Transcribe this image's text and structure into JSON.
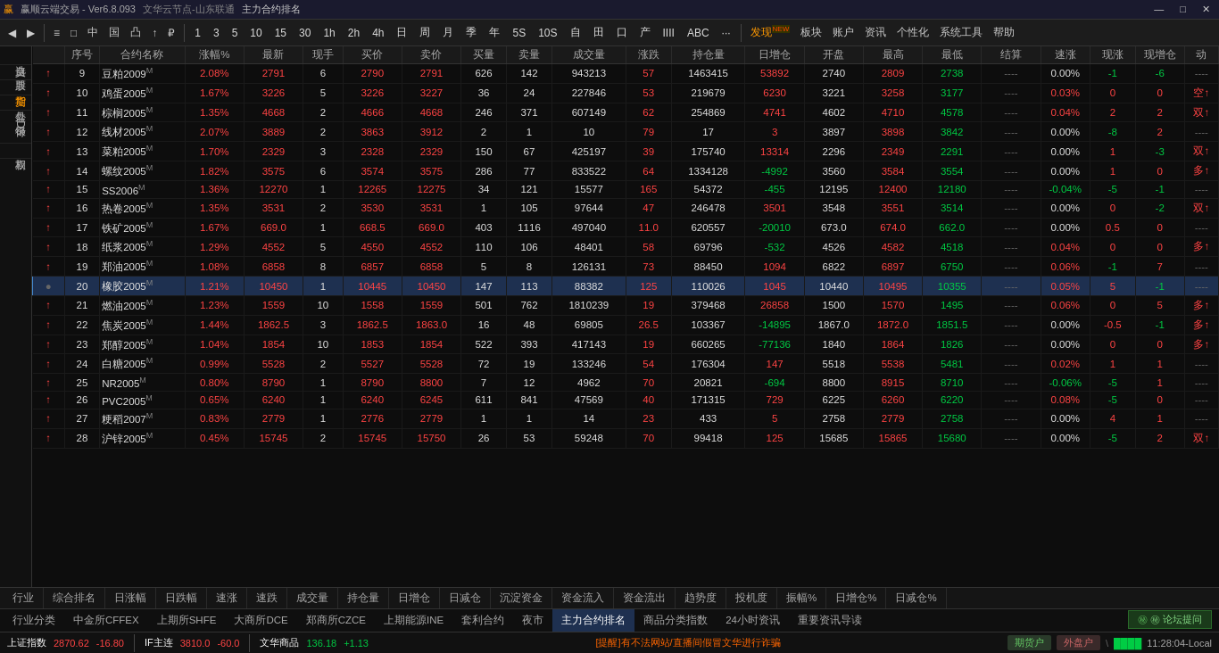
{
  "titlebar": {
    "title": "赢顺云端交易 - Ver6.8.093",
    "server": "文华云节点-山东联通",
    "contract": "主力合约排名",
    "minimize": "—",
    "maximize": "□",
    "close": "✕"
  },
  "toolbar": {
    "nav_back": "◀",
    "nav_fwd": "▶",
    "buttons": [
      "≡",
      "□",
      "中",
      "国",
      "凸",
      "↑",
      "₽"
    ],
    "periods": [
      "1",
      "3",
      "5",
      "10",
      "15",
      "30",
      "1h",
      "2h",
      "4h",
      "日",
      "周",
      "月",
      "季",
      "年",
      "5S",
      "10S",
      "自",
      "田",
      "口",
      "产",
      "IIII",
      "ABC",
      "···"
    ],
    "tools_right": [
      "发现",
      "板块",
      "账户",
      "资讯",
      "个性化",
      "系统工具",
      "帮助"
    ]
  },
  "sidebar": {
    "items": [
      "自选义",
      "股票",
      "期货",
      "外盘",
      "银行IDS",
      "期权"
    ]
  },
  "table": {
    "headers": [
      "序号",
      "合约名称",
      "涨幅%",
      "最新",
      "现手",
      "买价",
      "卖价",
      "买量",
      "卖量",
      "成交量",
      "涨跌",
      "持仓量",
      "日增仓",
      "开盘",
      "最高",
      "最低",
      "结算",
      "速涨",
      "现涨",
      "现增仓",
      "动"
    ],
    "rows": [
      {
        "seq": "↑",
        "num": "9",
        "name": "豆粕2009",
        "tag": "M",
        "pct": "2.08%",
        "last": "2791",
        "hand": "6",
        "buy": "2790",
        "sell": "2791",
        "bvol": "626",
        "svol": "142",
        "deal": "943213",
        "limit": "57",
        "pos": "1463415",
        "dadd": "53892",
        "open": "2740",
        "high": "2809",
        "low": "2738",
        "settle": "----",
        "speed": "0.00%",
        "xian": "-1",
        "cang": "-6",
        "dong": "----",
        "pct_color": "red",
        "last_color": "red"
      },
      {
        "seq": "↑",
        "num": "10",
        "name": "鸡蛋2005",
        "tag": "M",
        "pct": "1.67%",
        "last": "3226",
        "hand": "5",
        "buy": "3226",
        "sell": "3227",
        "bvol": "36",
        "svol": "24",
        "deal": "227846",
        "limit": "53",
        "pos": "219679",
        "dadd": "6230",
        "open": "3221",
        "high": "3258",
        "low": "3177",
        "settle": "----",
        "speed": "0.03%",
        "xian": "0",
        "cang": "0",
        "dong": "空↑",
        "pct_color": "red",
        "last_color": "red"
      },
      {
        "seq": "↑",
        "num": "11",
        "name": "棕榈2005",
        "tag": "M",
        "pct": "1.35%",
        "last": "4668",
        "hand": "2",
        "buy": "4666",
        "sell": "4668",
        "bvol": "246",
        "svol": "371",
        "deal": "607149",
        "limit": "62",
        "pos": "254869",
        "dadd": "4741",
        "open": "4602",
        "high": "4710",
        "low": "4578",
        "settle": "----",
        "speed": "0.04%",
        "xian": "2",
        "cang": "2",
        "dong": "双↑",
        "pct_color": "red",
        "last_color": "red"
      },
      {
        "seq": "↑",
        "num": "12",
        "name": "线材2005",
        "tag": "M",
        "pct": "2.07%",
        "last": "3889",
        "hand": "2",
        "buy": "3863",
        "sell": "3912",
        "bvol": "2",
        "svol": "1",
        "deal": "10",
        "limit": "79",
        "pos": "17",
        "dadd": "3",
        "open": "3897",
        "high": "3898",
        "low": "3842",
        "settle": "----",
        "speed": "0.00%",
        "xian": "-8",
        "cang": "2",
        "dong": "----",
        "pct_color": "red",
        "last_color": "red"
      },
      {
        "seq": "↑",
        "num": "13",
        "name": "菜粕2005",
        "tag": "M",
        "pct": "1.70%",
        "last": "2329",
        "hand": "3",
        "buy": "2328",
        "sell": "2329",
        "bvol": "150",
        "svol": "67",
        "deal": "425197",
        "limit": "39",
        "pos": "175740",
        "dadd": "13314",
        "open": "2296",
        "high": "2349",
        "low": "2291",
        "settle": "----",
        "speed": "0.00%",
        "xian": "1",
        "cang": "-3",
        "dong": "双↑",
        "pct_color": "red",
        "last_color": "red"
      },
      {
        "seq": "↑",
        "num": "14",
        "name": "螺纹2005",
        "tag": "M",
        "pct": "1.82%",
        "last": "3575",
        "hand": "6",
        "buy": "3574",
        "sell": "3575",
        "bvol": "286",
        "svol": "77",
        "deal": "833522",
        "limit": "64",
        "pos": "1334128",
        "dadd": "-4992",
        "open": "3560",
        "high": "3584",
        "low": "3554",
        "settle": "----",
        "speed": "0.00%",
        "xian": "1",
        "cang": "0",
        "dong": "多↑",
        "pct_color": "red",
        "last_color": "red"
      },
      {
        "seq": "↑",
        "num": "15",
        "name": "SS2006",
        "tag": "M",
        "pct": "1.36%",
        "last": "12270",
        "hand": "1",
        "buy": "12265",
        "sell": "12275",
        "bvol": "34",
        "svol": "121",
        "deal": "15577",
        "limit": "165",
        "pos": "54372",
        "dadd": "-455",
        "open": "12195",
        "high": "12400",
        "low": "12180",
        "settle": "----",
        "speed": "-0.04%",
        "xian": "-5",
        "cang": "-1",
        "dong": "----",
        "pct_color": "red",
        "last_color": "red"
      },
      {
        "seq": "↑",
        "num": "16",
        "name": "热卷2005",
        "tag": "M",
        "pct": "1.35%",
        "last": "3531",
        "hand": "2",
        "buy": "3530",
        "sell": "3531",
        "bvol": "1",
        "svol": "105",
        "deal": "97644",
        "limit": "47",
        "pos": "246478",
        "dadd": "3501",
        "open": "3548",
        "high": "3551",
        "low": "3514",
        "settle": "----",
        "speed": "0.00%",
        "xian": "0",
        "cang": "-2",
        "dong": "双↑",
        "pct_color": "red",
        "last_color": "red"
      },
      {
        "seq": "↑",
        "num": "17",
        "name": "铁矿2005",
        "tag": "M",
        "pct": "1.67%",
        "last": "669.0",
        "hand": "1",
        "buy": "668.5",
        "sell": "669.0",
        "bvol": "403",
        "svol": "1116",
        "deal": "497040",
        "limit": "11.0",
        "pos": "620557",
        "dadd": "-20010",
        "open": "673.0",
        "high": "674.0",
        "low": "662.0",
        "settle": "----",
        "speed": "0.00%",
        "xian": "0.5",
        "cang": "0",
        "dong": "----",
        "pct_color": "red",
        "last_color": "red"
      },
      {
        "seq": "↑",
        "num": "18",
        "name": "纸浆2005",
        "tag": "M",
        "pct": "1.29%",
        "last": "4552",
        "hand": "5",
        "buy": "4550",
        "sell": "4552",
        "bvol": "110",
        "svol": "106",
        "deal": "48401",
        "limit": "58",
        "pos": "69796",
        "dadd": "-532",
        "open": "4526",
        "high": "4582",
        "low": "4518",
        "settle": "----",
        "speed": "0.04%",
        "xian": "0",
        "cang": "0",
        "dong": "多↑",
        "pct_color": "red",
        "last_color": "red"
      },
      {
        "seq": "↑",
        "num": "19",
        "name": "郑油2005",
        "tag": "M",
        "pct": "1.08%",
        "last": "6858",
        "hand": "8",
        "buy": "6857",
        "sell": "6858",
        "bvol": "5",
        "svol": "8",
        "deal": "126131",
        "limit": "73",
        "pos": "88450",
        "dadd": "1094",
        "open": "6822",
        "high": "6897",
        "low": "6750",
        "settle": "----",
        "speed": "0.06%",
        "xian": "-1",
        "cang": "7",
        "dong": "----",
        "pct_color": "red",
        "last_color": "red"
      },
      {
        "seq": "●",
        "num": "20",
        "name": "橡胶2005",
        "tag": "M",
        "pct": "1.21%",
        "last": "10450",
        "hand": "1",
        "buy": "10445",
        "sell": "10450",
        "bvol": "147",
        "svol": "113",
        "deal": "88382",
        "limit": "125",
        "pos": "110026",
        "dadd": "1045",
        "open": "10440",
        "high": "10495",
        "low": "10355",
        "settle": "----",
        "speed": "0.05%",
        "xian": "5",
        "cang": "-1",
        "dong": "----",
        "pct_color": "red",
        "last_color": "red",
        "selected": true
      },
      {
        "seq": "↑",
        "num": "21",
        "name": "燃油2005",
        "tag": "M",
        "pct": "1.23%",
        "last": "1559",
        "hand": "10",
        "buy": "1558",
        "sell": "1559",
        "bvol": "501",
        "svol": "762",
        "deal": "1810239",
        "limit": "19",
        "pos": "379468",
        "dadd": "26858",
        "open": "1500",
        "high": "1570",
        "low": "1495",
        "settle": "----",
        "speed": "0.06%",
        "xian": "0",
        "cang": "5",
        "dong": "多↑",
        "pct_color": "red",
        "last_color": "red"
      },
      {
        "seq": "↑",
        "num": "22",
        "name": "焦炭2005",
        "tag": "M",
        "pct": "1.44%",
        "last": "1862.5",
        "hand": "3",
        "buy": "1862.5",
        "sell": "1863.0",
        "bvol": "16",
        "svol": "48",
        "deal": "69805",
        "limit": "26.5",
        "pos": "103367",
        "dadd": "-14895",
        "open": "1867.0",
        "high": "1872.0",
        "low": "1851.5",
        "settle": "----",
        "speed": "0.00%",
        "xian": "-0.5",
        "cang": "-1",
        "dong": "多↑",
        "pct_color": "red",
        "last_color": "red"
      },
      {
        "seq": "↑",
        "num": "23",
        "name": "郑醇2005",
        "tag": "M",
        "pct": "1.04%",
        "last": "1854",
        "hand": "10",
        "buy": "1853",
        "sell": "1854",
        "bvol": "522",
        "svol": "393",
        "deal": "417143",
        "limit": "19",
        "pos": "660265",
        "dadd": "-77136",
        "open": "1840",
        "high": "1864",
        "low": "1826",
        "settle": "----",
        "speed": "0.00%",
        "xian": "0",
        "cang": "0",
        "dong": "多↑",
        "pct_color": "red",
        "last_color": "red"
      },
      {
        "seq": "↑",
        "num": "24",
        "name": "白糖2005",
        "tag": "M",
        "pct": "0.99%",
        "last": "5528",
        "hand": "2",
        "buy": "5527",
        "sell": "5528",
        "bvol": "72",
        "svol": "19",
        "deal": "133246",
        "limit": "54",
        "pos": "176304",
        "dadd": "147",
        "open": "5518",
        "high": "5538",
        "low": "5481",
        "settle": "----",
        "speed": "0.02%",
        "xian": "1",
        "cang": "1",
        "dong": "----",
        "pct_color": "red",
        "last_color": "red"
      },
      {
        "seq": "↑",
        "num": "25",
        "name": "NR2005",
        "tag": "M",
        "pct": "0.80%",
        "last": "8790",
        "hand": "1",
        "buy": "8790",
        "sell": "8800",
        "bvol": "7",
        "svol": "12",
        "deal": "4962",
        "limit": "70",
        "pos": "20821",
        "dadd": "-694",
        "open": "8800",
        "high": "8915",
        "low": "8710",
        "settle": "----",
        "speed": "-0.06%",
        "xian": "-5",
        "cang": "1",
        "dong": "----",
        "pct_color": "red",
        "last_color": "red"
      },
      {
        "seq": "↑",
        "num": "26",
        "name": "PVC2005",
        "tag": "M",
        "pct": "0.65%",
        "last": "6240",
        "hand": "1",
        "buy": "6240",
        "sell": "6245",
        "bvol": "611",
        "svol": "841",
        "deal": "47569",
        "limit": "40",
        "pos": "171315",
        "dadd": "729",
        "open": "6225",
        "high": "6260",
        "low": "6220",
        "settle": "----",
        "speed": "0.08%",
        "xian": "-5",
        "cang": "0",
        "dong": "----",
        "pct_color": "red",
        "last_color": "red"
      },
      {
        "seq": "↑",
        "num": "27",
        "name": "粳稻2007",
        "tag": "M",
        "pct": "0.83%",
        "last": "2779",
        "hand": "1",
        "buy": "2776",
        "sell": "2779",
        "bvol": "1",
        "svol": "1",
        "deal": "14",
        "limit": "23",
        "pos": "433",
        "dadd": "5",
        "open": "2758",
        "high": "2779",
        "low": "2758",
        "settle": "----",
        "speed": "0.00%",
        "xian": "4",
        "cang": "1",
        "dong": "----",
        "pct_color": "red",
        "last_color": "red"
      },
      {
        "seq": "↑",
        "num": "28",
        "name": "沪锌2005",
        "tag": "M",
        "pct": "0.45%",
        "last": "15745",
        "hand": "2",
        "buy": "15745",
        "sell": "15750",
        "bvol": "26",
        "svol": "53",
        "deal": "59248",
        "limit": "70",
        "pos": "99418",
        "dadd": "125",
        "open": "15685",
        "high": "15865",
        "low": "15680",
        "settle": "----",
        "speed": "0.00%",
        "xian": "-5",
        "cang": "2",
        "dong": "双↑",
        "pct_color": "red",
        "last_color": "red"
      }
    ]
  },
  "bottom_tabs": {
    "items": [
      "行业",
      "综合排名",
      "日涨幅",
      "日跌幅",
      "速涨",
      "速跌",
      "成交量",
      "持仓量",
      "日增仓",
      "日减仓",
      "沉淀资金",
      "资金流入",
      "资金流出",
      "趋势度",
      "投机度",
      "振幅%",
      "日增仓%",
      "日减仓%"
    ]
  },
  "nav_tabs": {
    "items": [
      "行业分类",
      "中金所CFFEX",
      "上期所SHFE",
      "大商所DCE",
      "郑商所CZCE",
      "上期能源INE",
      "套利合约",
      "夜市",
      "主力合约排名",
      "商品分类指数",
      "24小时资讯",
      "重要资讯导读"
    ],
    "active": "主力合约排名"
  },
  "statusbar": {
    "forum_btn": "㊙ 论坛提问",
    "index1_label": "上证指数",
    "index1_val": "2870.62",
    "index1_change": "-16.80",
    "index2_label": "IF主连",
    "index2_val": "3810.0",
    "index2_change": "-60.0",
    "index3_label": "文华商品",
    "index3_val": "136.18",
    "index3_change": "+1.13",
    "warn": "[提醒]有不法网站/直播间假冒文华进行诈骗",
    "account1": "期货户",
    "account2": "外盘户",
    "sep": "\\",
    "signal": "████",
    "time": "11:28:04-Local"
  }
}
